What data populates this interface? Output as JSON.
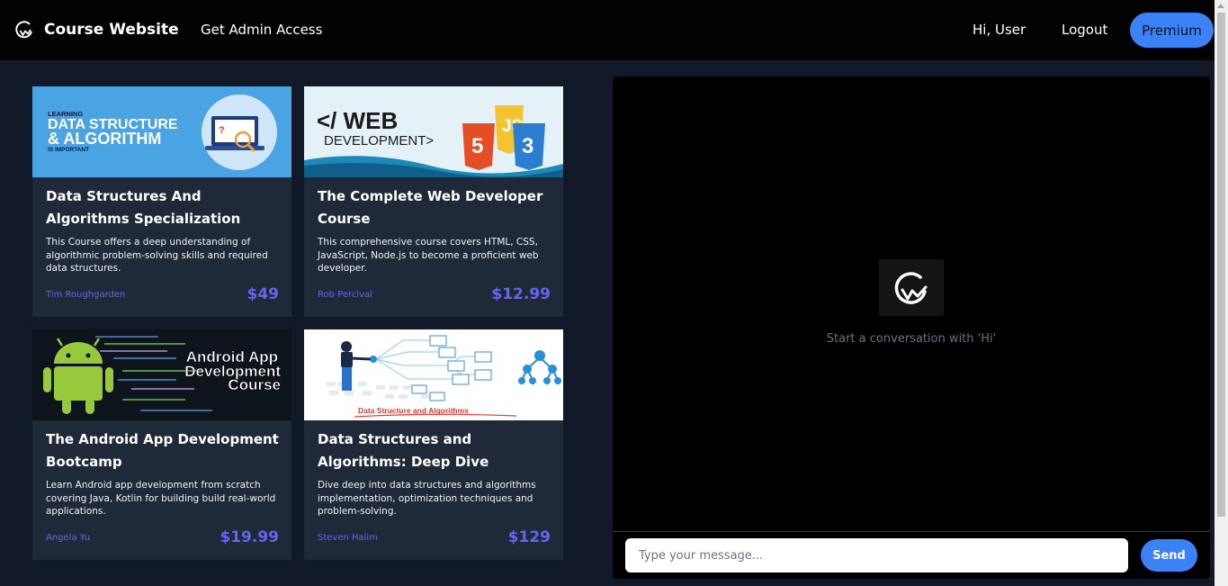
{
  "header": {
    "brand": "Course Website",
    "admin_link": "Get Admin Access",
    "greeting": "Hi, User",
    "logout": "Logout",
    "premium": "Premium"
  },
  "courses": [
    {
      "title": "Data Structures And Algorithms Specialization",
      "description": "This Course offers a deep understanding of algorithmic problem-solving skills and required data structures.",
      "author": "Tim Roughgarden",
      "price": "$49",
      "image": {
        "line1": "LEARNING",
        "line2": "DATA STRUCTURE",
        "line3": "& ALGORITHM",
        "line4": "IS IMPORTANT"
      }
    },
    {
      "title": "The Complete Web Developer Course",
      "description": "This comprehensive course covers HTML, CSS, JavaScript, Node.js to become a proficient web developer.",
      "author": "Rob Percival",
      "price": "$12.99",
      "image": {
        "line1": "</ WEB",
        "line2": "DEVELOPMENT>"
      }
    },
    {
      "title": "The Android App Development Bootcamp",
      "description": "Learn Android app development from scratch covering Java, Kotlin for building build real-world applications.",
      "author": "Angela Yu",
      "price": "$19.99",
      "image": {
        "line1": "Android App",
        "line2": "Development",
        "line3": "Course"
      }
    },
    {
      "title": "Data Structures and Algorithms: Deep Dive",
      "description": "Dive deep into data structures and algorithms implementation, optimization techniques and problem-solving.",
      "author": "Steven Halim",
      "price": "$129",
      "image": {
        "line1": "Data Structure and Algorithms"
      }
    }
  ],
  "chat": {
    "empty_hint": "Start a conversation with 'Hi'",
    "input_placeholder": "Type your message...",
    "send": "Send"
  },
  "colors": {
    "accent": "#3b82f6",
    "price": "#6366f1",
    "card_bg": "#1f2937",
    "page_bg": "#111827"
  }
}
